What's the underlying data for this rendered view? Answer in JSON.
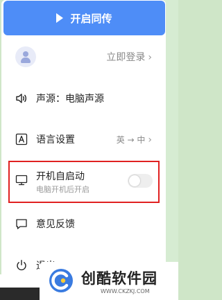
{
  "header": {
    "sync_label": "开启同传"
  },
  "login": {
    "text": "立即登录",
    "chevron": "›"
  },
  "menu": {
    "sound": {
      "label": "声源：电脑声源",
      "icon": "speaker-icon"
    },
    "language": {
      "label": "语言设置",
      "value": "英 → 中",
      "chevron": "›",
      "icon": "language-a-icon"
    },
    "autostart": {
      "label": "开机自启动",
      "sub": "电脑开机后开启",
      "enabled": false,
      "icon": "monitor-icon"
    },
    "feedback": {
      "label": "意见反馈",
      "icon": "feedback-icon"
    },
    "logout": {
      "label": "退出",
      "icon": "power-icon"
    }
  },
  "watermark": {
    "name": "创酷软件园",
    "url": "WWW.CKZKJ.COM"
  },
  "colors": {
    "primary": "#4e8df7",
    "highlight_border": "#e02020",
    "background": "#cfe6c8"
  }
}
